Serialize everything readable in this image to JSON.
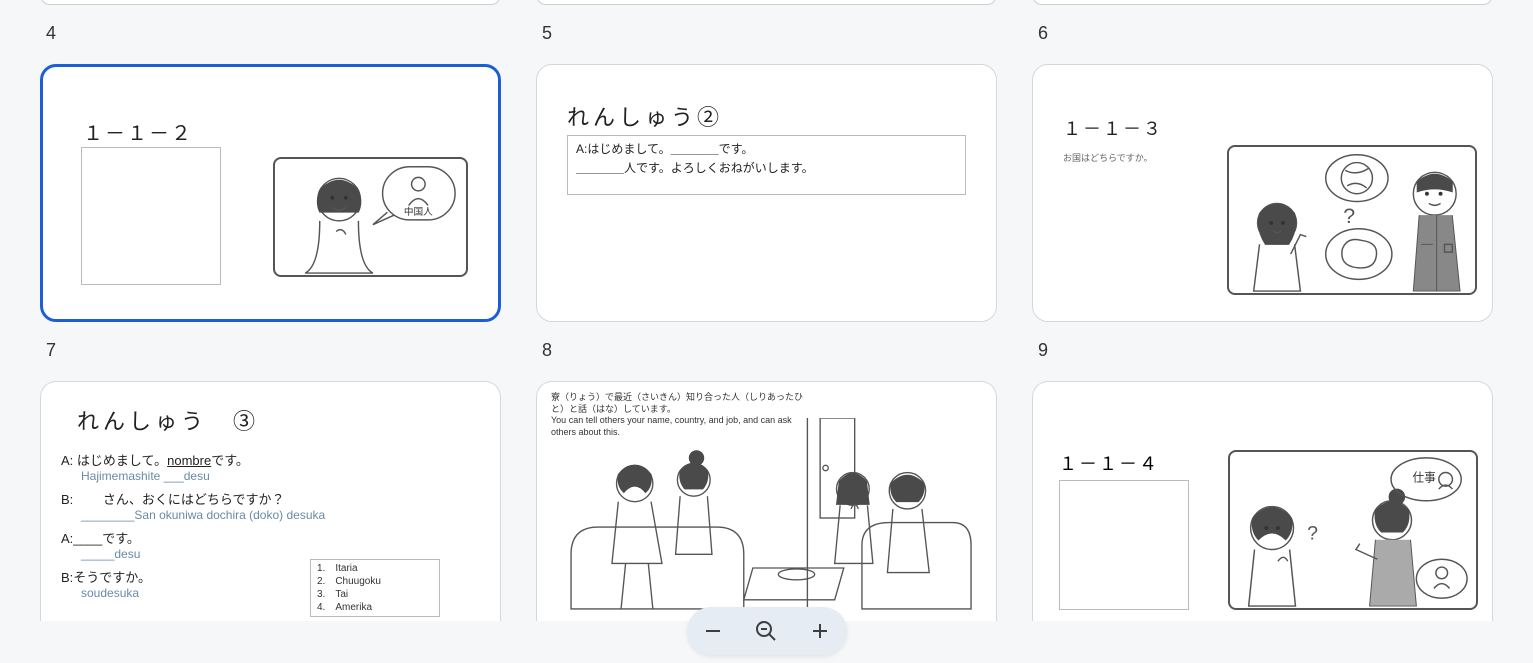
{
  "labels": {
    "n4": "4",
    "n5": "5",
    "n6": "6",
    "n7": "7",
    "n8": "8",
    "n9": "9"
  },
  "slide7": {
    "header": "１－１－２",
    "bubble": "中国人"
  },
  "slide8": {
    "title": "れんしゅう②",
    "line1": "A:はじめまして。＿＿＿＿です。",
    "line2": "＿＿＿＿人です。よろしくおねがいします。"
  },
  "slide9": {
    "header": "１－１－３",
    "sub": "お国はどちらですか。"
  },
  "slide10": {
    "title": "れんしゅう　③",
    "a1": "A: はじめまして。",
    "a1_underline": "nombre",
    "a1_tail": "です。",
    "a1r": "Hajimemashite ___desu",
    "b1": "B: 　　さん、おくにはどちらですか？",
    "b1r": "________San okuniwa dochira (doko) desuka",
    "a2": "A:____です。",
    "a2r": "_____desu",
    "b2": "B:そうですか。",
    "b2r": "soudesuka",
    "opts": [
      "1.　Itaria",
      "2.　Chuugoku",
      "3.　Tai",
      "4.　Amerika"
    ]
  },
  "slide11": {
    "cap_jp": "寮（りょう）で最近（さいきん）知り合った人（しりあったひと）と話（はな）しています。",
    "cap_en": "You can tell others your name, country, and job, and can ask others about this."
  },
  "slide12": {
    "header": "１－１－４",
    "bubble": "仕事"
  },
  "zoom": {
    "out": "−",
    "in": "+"
  }
}
